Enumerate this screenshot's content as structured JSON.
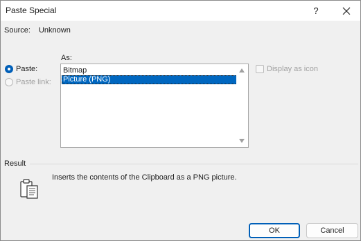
{
  "window": {
    "title": "Paste Special",
    "help_glyph": "?",
    "close_glyph": "✕"
  },
  "source": {
    "label": "Source:",
    "value": "Unknown"
  },
  "as_label": "As:",
  "options": {
    "paste_label": "Paste:",
    "paste_link_label": "Paste link:",
    "selected": "paste"
  },
  "list": {
    "items": [
      "Bitmap",
      "Picture (PNG)"
    ],
    "selected_index": 1
  },
  "display_as_icon": {
    "label": "Display as icon",
    "checked": false,
    "enabled": false
  },
  "result": {
    "label": "Result",
    "text": "Inserts the contents of the Clipboard as a PNG picture."
  },
  "buttons": {
    "ok": "OK",
    "cancel": "Cancel"
  },
  "colors": {
    "accent": "#005fb8",
    "selection": "#0067c0"
  }
}
